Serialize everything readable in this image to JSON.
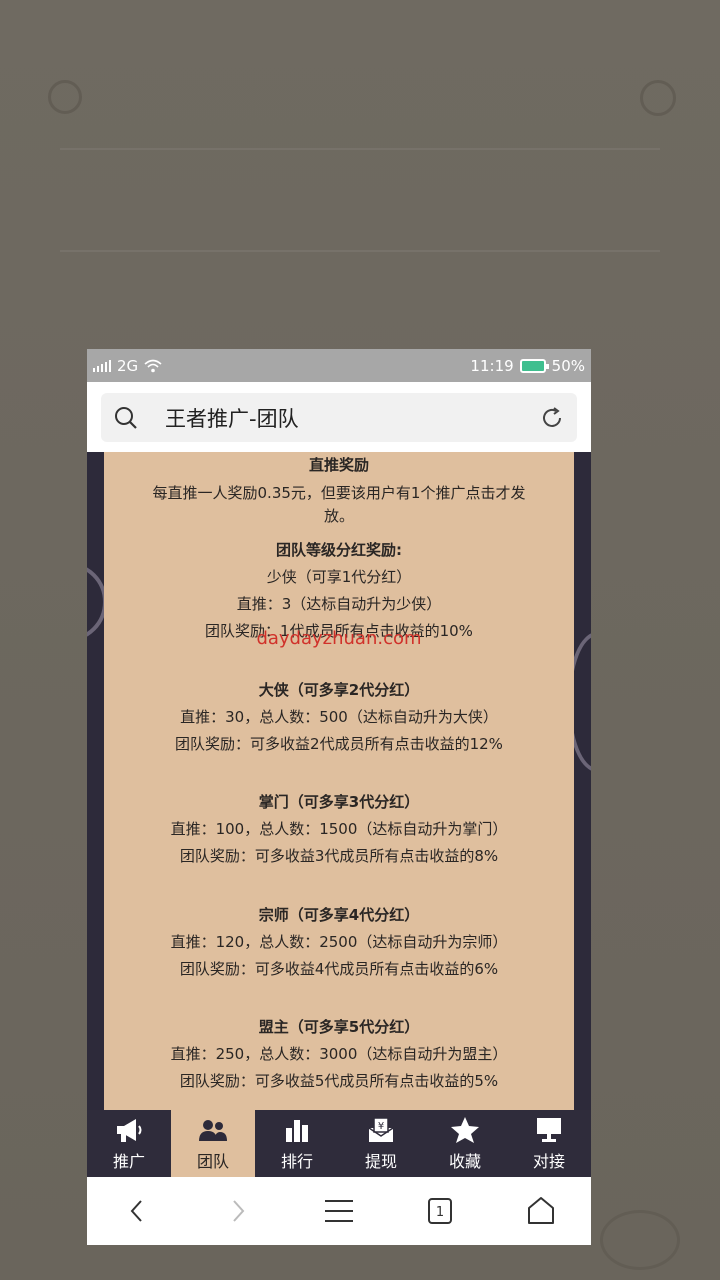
{
  "statusbar": {
    "network": "2G",
    "time": "11:19",
    "battery": "50%"
  },
  "addressbar": {
    "title": "王者推广-团队"
  },
  "content": {
    "direct_title": "直推奖励",
    "direct_line1": "每直推一人奖励0.35元，但要该用户有1个推广点击才发",
    "direct_line2": "放。",
    "team_title": "团队等级分红奖励:",
    "watermark": "daydayzhuan.com",
    "levels": [
      {
        "title": "少侠（可享1代分红）",
        "line1": "直推：3（达标自动升为少侠）",
        "line2": "团队奖励：1代成员所有点击收益的10%"
      },
      {
        "title": "大侠（可多享2代分红）",
        "line1": "直推：30，总人数：500（达标自动升为大侠）",
        "line2": "团队奖励：可多收益2代成员所有点击收益的12%"
      },
      {
        "title": "掌门（可多享3代分红）",
        "line1": "直推：100，总人数：1500（达标自动升为掌门）",
        "line2": "团队奖励：可多收益3代成员所有点击收益的8%"
      },
      {
        "title": "宗师（可多享4代分红）",
        "line1": "直推：120，总人数：2500（达标自动升为宗师）",
        "line2": "团队奖励：可多收益4代成员所有点击收益的6%"
      },
      {
        "title": "盟主（可多享5代分红）",
        "line1": "直推：250，总人数：3000（达标自动升为盟主）",
        "line2": "团队奖励：可多收益5代成员所有点击收益的5%"
      }
    ]
  },
  "tabs": [
    {
      "label": "推广",
      "icon": "megaphone-icon"
    },
    {
      "label": "团队",
      "icon": "team-icon",
      "active": true
    },
    {
      "label": "排行",
      "icon": "ranking-bars-icon"
    },
    {
      "label": "提现",
      "icon": "withdraw-icon"
    },
    {
      "label": "收藏",
      "icon": "star-icon"
    },
    {
      "label": "对接",
      "icon": "monitor-icon"
    }
  ],
  "browser_nav": {
    "tab_count": "1"
  },
  "colors": {
    "panel": "#dfbf9e",
    "dark": "#2d2a3a",
    "watermark": "#d0312a",
    "statusbar": "#a7a7a7"
  }
}
